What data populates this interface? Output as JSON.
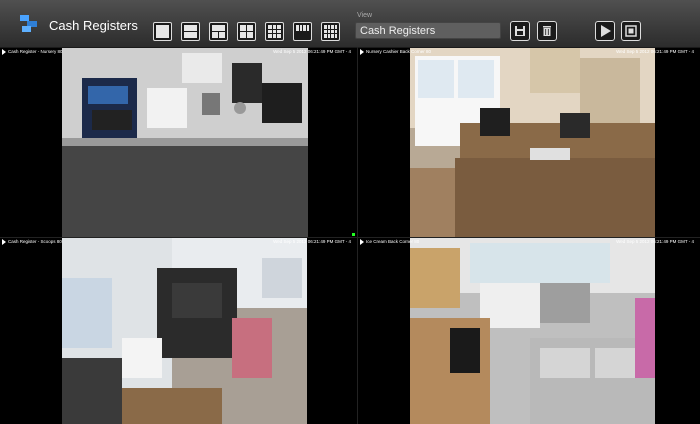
{
  "app": {
    "title": "Cash Registers"
  },
  "toolbar": {
    "view_label": "View",
    "view_value": "Cash Registers",
    "layouts": [
      "layout-1x1",
      "layout-1x2",
      "layout-2x1",
      "layout-2x2",
      "layout-3x3",
      "layout-4x4",
      "layout-5x5"
    ]
  },
  "cameras": [
    {
      "name": "Cash Register - Nursery 80",
      "timestamp": "Wed Sep 5 2012 06:21:49 PM GMT - 4"
    },
    {
      "name": "Nursery Cashier Back Corner 80",
      "timestamp": "Wed Sep 5 2012 06:21:49 PM GMT - 4"
    },
    {
      "name": "Cash Register - Scoops 80",
      "timestamp": "Wed Sep 5 2012 06:21:49 PM GMT - 4"
    },
    {
      "name": "Ice Cream Back Corner 80",
      "timestamp": "Wed Sep 5 2012 06:21:49 PM GMT - 4"
    }
  ]
}
